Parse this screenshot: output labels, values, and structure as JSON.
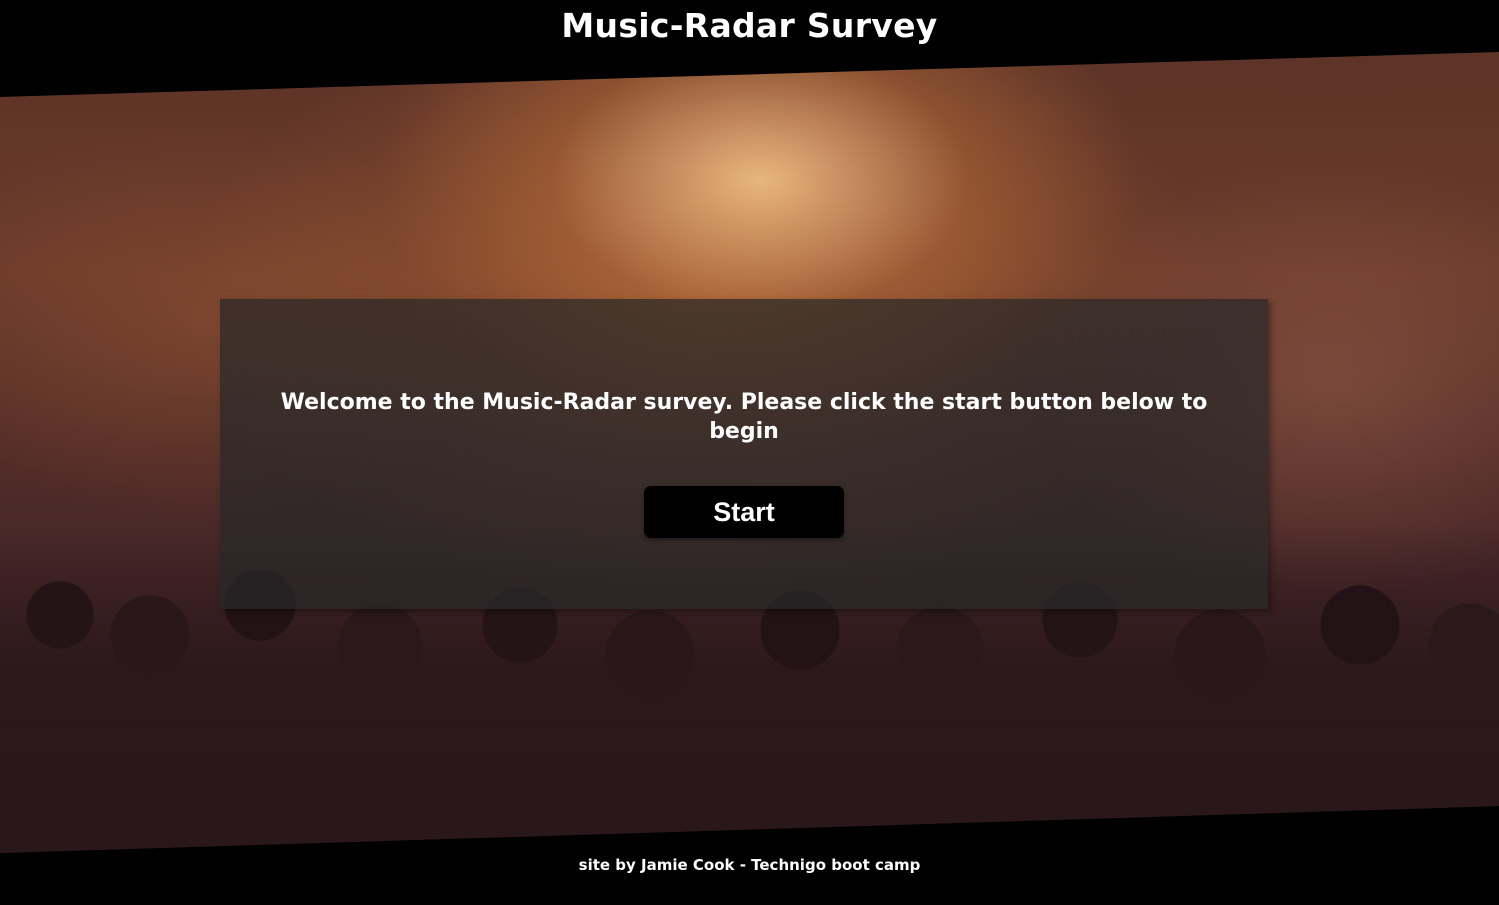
{
  "header": {
    "title": "Music-Radar Survey"
  },
  "hero": {
    "image": "concert-crowd-background"
  },
  "welcome": {
    "message": "Welcome to the Music-Radar survey. Please click the start button below to begin",
    "start_label": "Start"
  },
  "footer": {
    "credit": "site by Jamie Cook - Technigo boot camp"
  },
  "colors": {
    "page_background": "#000000",
    "text": "#ffffff",
    "button_background": "#000000",
    "panel_background": "rgba(40,40,40,0.72)"
  }
}
